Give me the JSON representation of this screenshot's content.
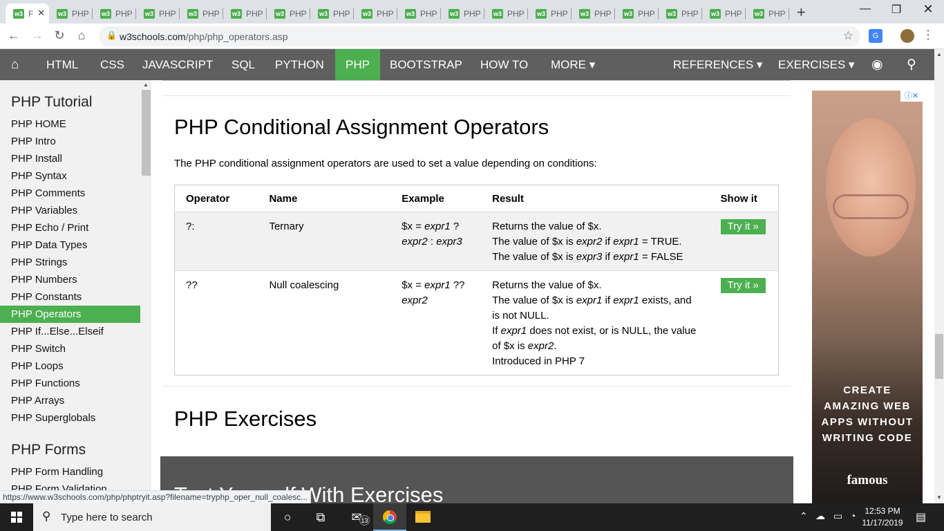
{
  "browser": {
    "tabs": [
      {
        "label": "F",
        "active": true
      },
      {
        "label": "PHP"
      },
      {
        "label": "PHP"
      },
      {
        "label": "PHP"
      },
      {
        "label": "PHP"
      },
      {
        "label": "PHP"
      },
      {
        "label": "PHP"
      },
      {
        "label": "PHP"
      },
      {
        "label": "PHP"
      },
      {
        "label": "PHP"
      },
      {
        "label": "PHP"
      },
      {
        "label": "PHP"
      },
      {
        "label": "PHP"
      },
      {
        "label": "PHP"
      },
      {
        "label": "PHP"
      },
      {
        "label": "PHP"
      },
      {
        "label": "PHP"
      },
      {
        "label": "PHP"
      }
    ],
    "favicon_text": "w3",
    "url_domain": "w3schools.com",
    "url_path": "/php/php_operators.asp",
    "status_url": "https://www.w3schools.com/php/phptryit.asp?filename=tryphp_oper_null_coalesc..."
  },
  "nav": {
    "items": [
      "HTML",
      "CSS",
      "JAVASCRIPT",
      "SQL",
      "PYTHON",
      "PHP",
      "BOOTSTRAP",
      "HOW TO",
      "MORE ▾"
    ],
    "right_items": [
      "REFERENCES ▾",
      "EXERCISES ▾"
    ],
    "active_item": "PHP",
    "accent_color": "#4caf50"
  },
  "sidebar": {
    "heading1": "PHP Tutorial",
    "links": [
      "PHP HOME",
      "PHP Intro",
      "PHP Install",
      "PHP Syntax",
      "PHP Comments",
      "PHP Variables",
      "PHP Echo / Print",
      "PHP Data Types",
      "PHP Strings",
      "PHP Numbers",
      "PHP Constants",
      "PHP Operators",
      "PHP If...Else...Elseif",
      "PHP Switch",
      "PHP Loops",
      "PHP Functions",
      "PHP Arrays",
      "PHP Superglobals"
    ],
    "active_link": "PHP Operators",
    "heading2": "PHP Forms",
    "links2": [
      "PHP Form Handling",
      "PHP Form Validation"
    ]
  },
  "main": {
    "heading": "PHP Conditional Assignment Operators",
    "intro": "The PHP conditional assignment operators are used to set a value depending on conditions:",
    "table": {
      "headers": [
        "Operator",
        "Name",
        "Example",
        "Result",
        "Show it"
      ],
      "rows": [
        {
          "operator": "?:",
          "name": "Ternary",
          "example_html": "$x = <i>expr1</i> ? <i>expr2</i> : <i>expr3</i>",
          "result_html": "Returns the value of $x.<br>The value of $x is <i>expr2</i> if <i>expr1</i> = TRUE.<br>The value of $x is <i>expr3</i> if <i>expr1</i> = FALSE",
          "button": "Try it »"
        },
        {
          "operator": "??",
          "name": "Null coalescing",
          "example_html": "$x = <i>expr1</i> ?? <i>expr2</i>",
          "result_html": "Returns the value of $x.<br>The value of $x is <i>expr1</i> if <i>expr1</i> exists, and is not NULL.<br>If <i>expr1</i> does not exist, or is NULL, the value of $x is <i>expr2</i>.<br>Introduced in PHP 7",
          "button": "Try it »"
        }
      ]
    },
    "exercises_heading": "PHP Exercises",
    "exercise_box_title": "Test Yourself With Exercises"
  },
  "ad": {
    "adchoices": "ⓘ✕",
    "text_lines": [
      "CREATE",
      "AMAZING WEB",
      "APPS WITHOUT",
      "WRITING CODE"
    ],
    "brand": "famous"
  },
  "taskbar": {
    "search_placeholder": "Type here to search",
    "mail_badge": "13",
    "time": "12:53 PM",
    "date": "11/17/2019"
  }
}
